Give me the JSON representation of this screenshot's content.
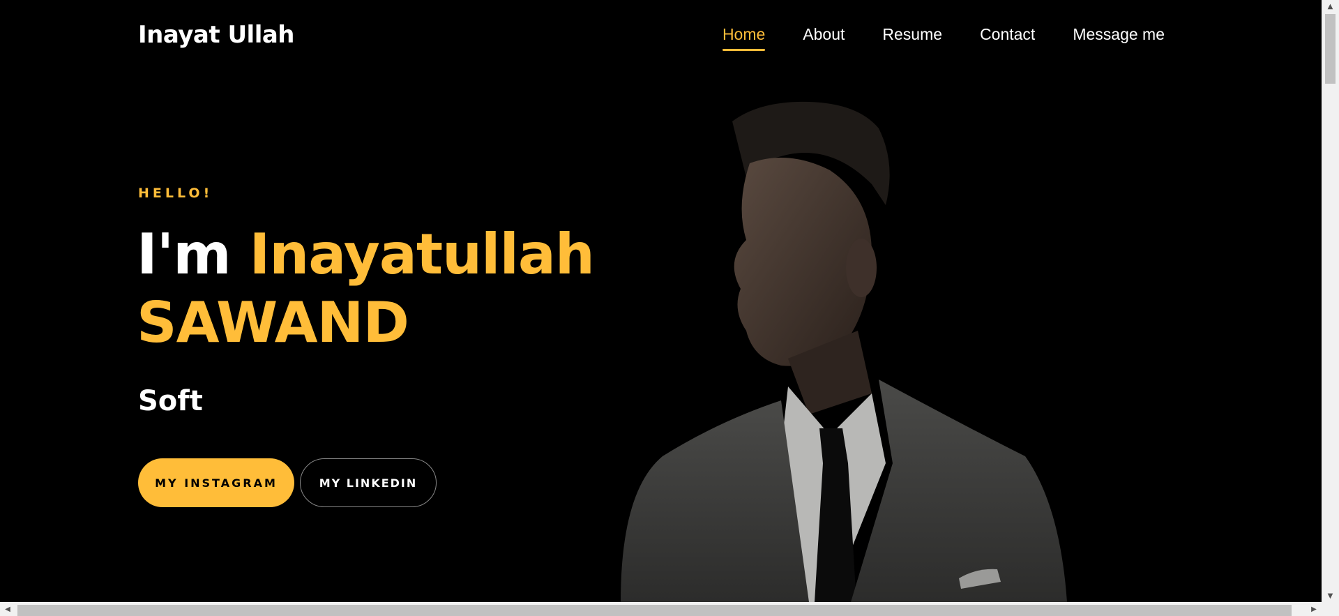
{
  "header": {
    "brand": "Inayat Ullah",
    "nav": [
      {
        "label": "Home",
        "active": true
      },
      {
        "label": "About"
      },
      {
        "label": "Resume"
      },
      {
        "label": "Contact"
      },
      {
        "label": "Message me"
      }
    ]
  },
  "hero": {
    "greeting": "HELLO!",
    "headline_prefix": "I'm",
    "headline_name_1": "Inayatullah",
    "headline_name_2": "SAWAND",
    "role": "Soft",
    "buttons": {
      "primary": "MY INSTAGRAM",
      "secondary": "MY LINKEDIN"
    },
    "image": "portrait-photo"
  },
  "colors": {
    "accent": "#ffbd39",
    "background": "#000000",
    "text": "#ffffff"
  },
  "icons": [
    "scroll-up-arrow-icon",
    "scroll-down-arrow-icon",
    "scroll-left-arrow-icon",
    "scroll-right-arrow-icon"
  ]
}
